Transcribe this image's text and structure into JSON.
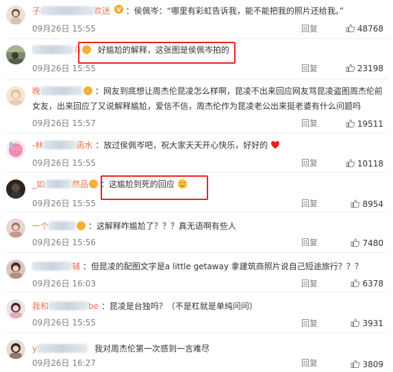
{
  "comments": [
    {
      "user": "子",
      "user_tail": "欢迷",
      "badge": "V",
      "text": "：侯佩岑：“哪里有彩虹告诉我，能不能把我的照片还给我。”",
      "time": "09月26日 15:55",
      "reply": "回复",
      "likes": "48768"
    },
    {
      "user": "",
      "user_tail": "",
      "text": "好尴尬的解释，这张图是侯佩岑拍的",
      "time": "09月26日 15:55",
      "reply": "回复",
      "likes": "23198"
    },
    {
      "user": "晚",
      "user_tail": "",
      "text": "：网友到底想让周杰伦昆凌怎么样啊，昆凌不出来回应网友骂昆凌盗图周杰伦前",
      "text2": "女友，出来回应了又说解释尴尬，爱信不信，周杰伦作为昆凌老公出来挺老婆有什么问题吗",
      "time": "09月26日 15:57",
      "reply": "回复",
      "likes": "19511"
    },
    {
      "user": "-林",
      "user_tail": "函水",
      "text": "：放过侯佩岑吧，祝大家天天开心快乐，好好的",
      "time": "09月26日 15:55",
      "reply": "回复",
      "likes": "10118"
    },
    {
      "user": "_如",
      "user_tail": "然品",
      "text": "：这尴尬到死的回应",
      "time": "09月26日 15:55",
      "reply": "回复",
      "likes": "8954"
    },
    {
      "user": "一个",
      "user_tail": "",
      "text": "：这解释咋尴尬了？？？真无语啊有些人",
      "time": "09月26日 15:56",
      "reply": "回复",
      "likes": "7480"
    },
    {
      "user": "",
      "user_tail": "辅",
      "text": "：但昆凌的配图文字是a little getaway 拿建筑商照片说自己短途旅行？？？",
      "time": "09月26日 16:03",
      "reply": "回复",
      "likes": "6378"
    },
    {
      "user": "我和",
      "user_tail": "be",
      "text": "：昆凌是台独吗？（不是杠就是单纯问问）",
      "time": "09月26日 15:55",
      "reply": "回复",
      "likes": "3931"
    },
    {
      "user": "y",
      "user_tail": "",
      "text": "我对周杰伦第一次感到一言难尽",
      "time": "09月26日 16:27",
      "reply": "回复",
      "likes": "3809"
    }
  ],
  "colors": {
    "username": "#eb7350",
    "highlight": "#e8221b",
    "meta": "#808080"
  },
  "icons": {
    "like": "thumbs-up-icon",
    "verified": "verified-badge-icon",
    "heart": "red-heart-emoji",
    "smile": "smile-emoji"
  }
}
